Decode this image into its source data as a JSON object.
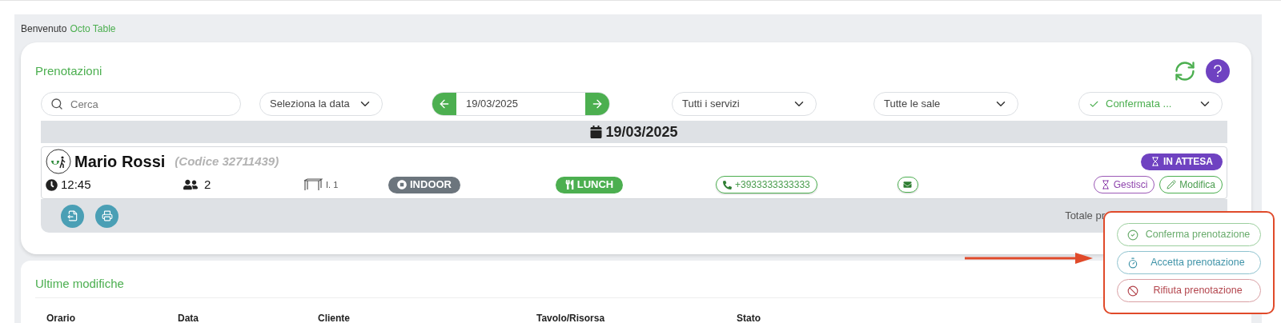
{
  "welcome": {
    "text": "Benvenuto",
    "name": "Octo Table"
  },
  "bookings": {
    "title": "Prenotazioni",
    "search": {
      "placeholder": "Cerca"
    },
    "date_select": "Seleziona la data",
    "date_nav": {
      "value": "19/03/2025"
    },
    "service_filter": "Tutti i servizi",
    "room_filter": "Tutte le sale",
    "status_filter": "Confermata ...",
    "date_header": "19/03/2025",
    "reservations": [
      {
        "name": "Mario Rossi",
        "code": "(Codice 32711439)",
        "time": "12:45",
        "guests": "2",
        "table": "I. 1",
        "area": "INDOOR",
        "service": "LUNCH",
        "phone": "+3933333333333",
        "status": "IN ATTESA",
        "actions": [
          {
            "label": "Gestisci",
            "kind": "manage"
          },
          {
            "label": "Modifica",
            "kind": "edit"
          }
        ]
      }
    ],
    "footer": {
      "total": "Totale pr"
    }
  },
  "status_menu": {
    "items": [
      {
        "label": "Conferma prenotazione",
        "kind": "confirm"
      },
      {
        "label": "Accetta prenotazione",
        "kind": "accept"
      },
      {
        "label": "Rifiuta prenotazione",
        "kind": "reject"
      }
    ]
  },
  "recent_changes": {
    "title": "Ultime modifiche",
    "columns": [
      "Orario",
      "Data",
      "Cliente",
      "Tavolo/Risorsa",
      "Stato"
    ]
  }
}
